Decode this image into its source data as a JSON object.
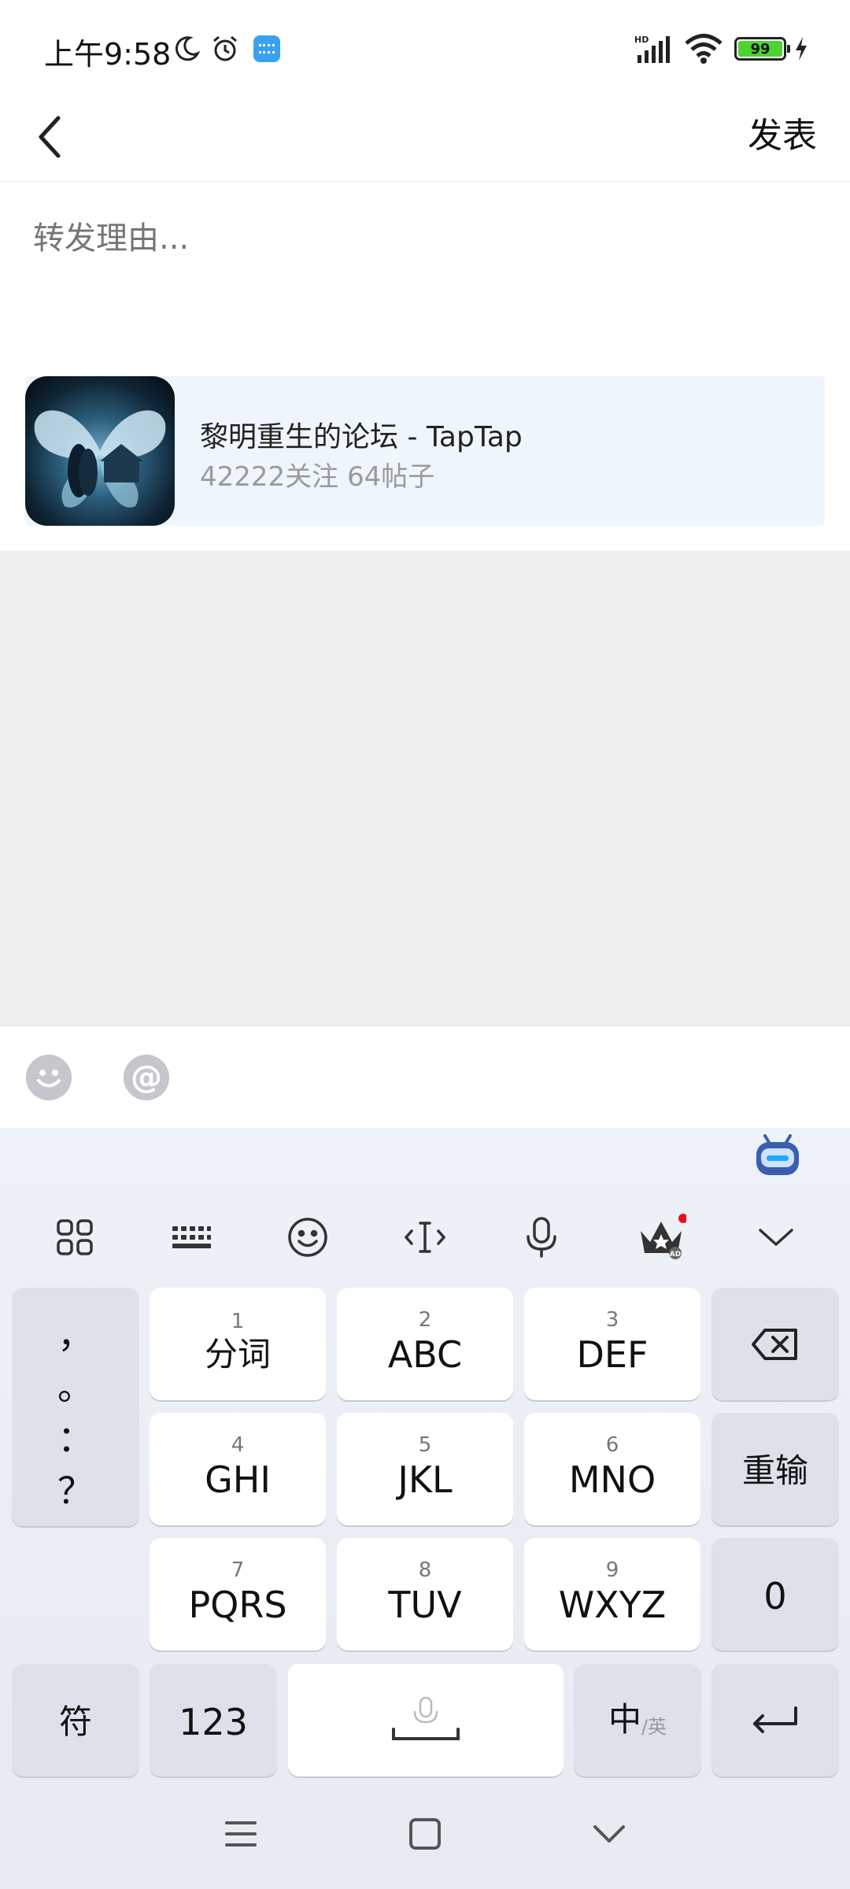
{
  "status_bar": {
    "time": "上午9:58",
    "battery": "99"
  },
  "header": {
    "publish_label": "发表"
  },
  "compose": {
    "reason_placeholder": "转发理由..."
  },
  "forum_card": {
    "title": "黎明重生的论坛 - TapTap",
    "subtitle": "42222关注 64帖子"
  },
  "keyboard": {
    "punctuation": [
      "，",
      "。",
      "：",
      "？"
    ],
    "keys": [
      {
        "num": "1",
        "label": "分词"
      },
      {
        "num": "2",
        "label": "ABC"
      },
      {
        "num": "3",
        "label": "DEF"
      },
      {
        "num": "4",
        "label": "GHI"
      },
      {
        "num": "5",
        "label": "JKL"
      },
      {
        "num": "6",
        "label": "MNO"
      },
      {
        "num": "7",
        "label": "PQRS"
      },
      {
        "num": "8",
        "label": "TUV"
      },
      {
        "num": "9",
        "label": "WXYZ"
      }
    ],
    "reenter_label": "重输",
    "zero_label": "0",
    "symbol_label": "符",
    "numbers_label": "123",
    "lang_label": "中",
    "lang_sub_label": "/英"
  },
  "colors": {
    "card_bg": "#eef5fd",
    "keyboard_bg": "#e8ecf2",
    "battery_green": "#4cd430",
    "notify_dot": "#e81123"
  }
}
